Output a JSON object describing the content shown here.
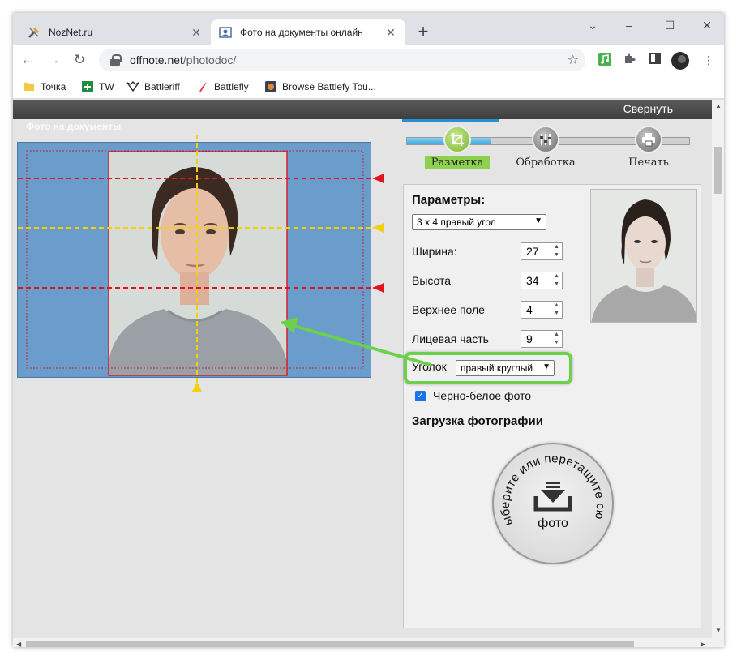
{
  "browser": {
    "tabs": [
      {
        "title": "NozNet.ru",
        "icon": "tools-icon",
        "active": false
      },
      {
        "title": "Фото на документы онлайн",
        "icon": "photo-doc-icon",
        "active": true
      }
    ],
    "url_host": "offnote.net",
    "url_path": "/photodoc/",
    "bookmarks": [
      {
        "label": "Точка",
        "icon": "folder-icon"
      },
      {
        "label": "TW",
        "icon": "tw-icon"
      },
      {
        "label": "Battleriff",
        "icon": "battleriff-icon"
      },
      {
        "label": "Battlefly",
        "icon": "battlefly-icon"
      },
      {
        "label": "Browse Battlefy Tou...",
        "icon": "battlefy-icon"
      }
    ]
  },
  "page": {
    "collapse_label": "Свернуть",
    "ghost_title": "Фото на документы",
    "steps": [
      {
        "label": "Разметка",
        "active": true
      },
      {
        "label": "Обработка",
        "active": false
      },
      {
        "label": "Печать",
        "active": false
      }
    ],
    "params": {
      "title": "Параметры:",
      "format_value": "3 х 4 правый угол",
      "fields": [
        {
          "label": "Ширина:",
          "value": "27"
        },
        {
          "label": "Высота",
          "value": "34"
        },
        {
          "label": "Верхнее поле",
          "value": "4"
        },
        {
          "label": "Лицевая часть",
          "value": "9"
        }
      ],
      "corner_label": "Уголок",
      "corner_value": "правый круглый",
      "bw_label": "Черно-белое фото",
      "bw_checked": true
    },
    "upload": {
      "title": "Загрузка фотографии",
      "arc_text": "Выберите или перетащите сюда",
      "center_text": "фото"
    }
  },
  "colors": {
    "photo_bg": "#6a9ccc",
    "guide_red": "#e0141e",
    "guide_yellow": "#f5d000",
    "highlight_green": "#6cd04a",
    "accent_blue": "#2a8fd2"
  }
}
